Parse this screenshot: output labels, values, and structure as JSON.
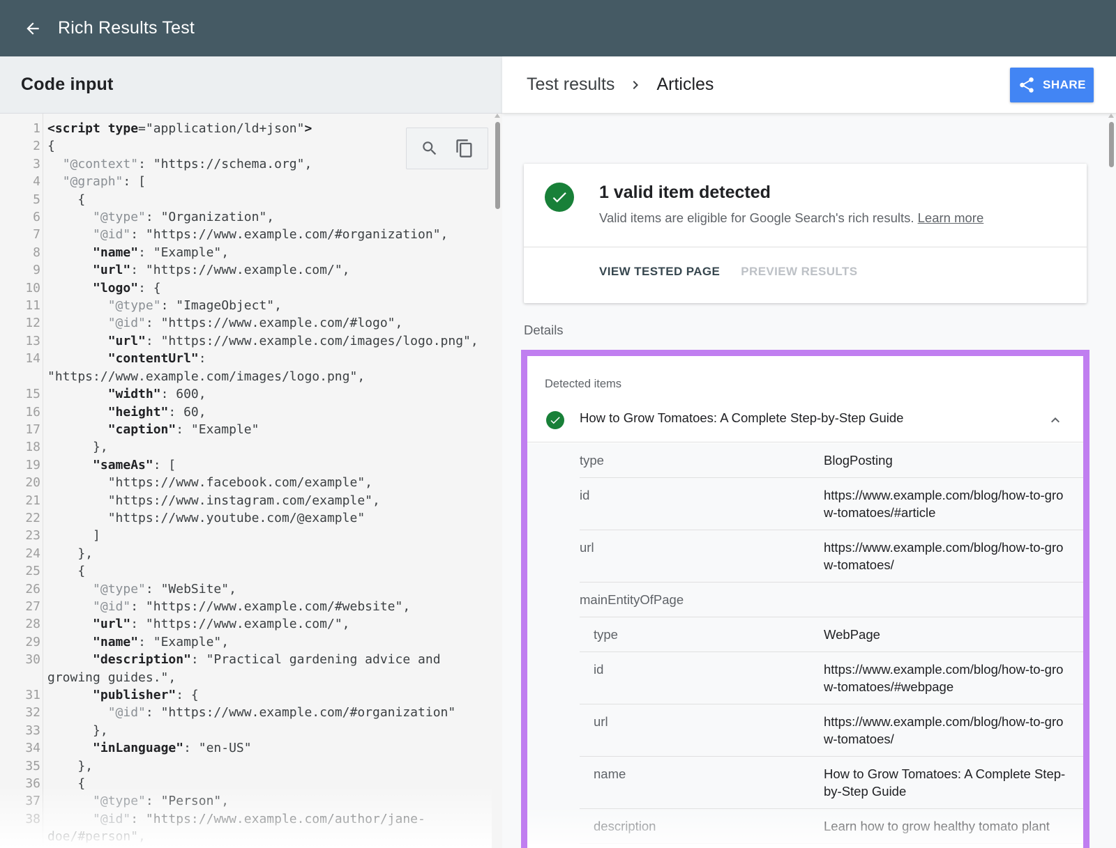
{
  "app": {
    "title": "Rich Results Test"
  },
  "left": {
    "header": "Code input",
    "code_lines": [
      {
        "n": "1",
        "t": "<script type=\"application/ld+json\">"
      },
      {
        "n": "2",
        "t": "{"
      },
      {
        "n": "3",
        "t": "  \"@context\": \"https://schema.org\","
      },
      {
        "n": "4",
        "t": "  \"@graph\": ["
      },
      {
        "n": "5",
        "t": "    {"
      },
      {
        "n": "6",
        "t": "      \"@type\": \"Organization\","
      },
      {
        "n": "7",
        "t": "      \"@id\": \"https://www.example.com/#organization\","
      },
      {
        "n": "8",
        "t": "      \"name\": \"Example\","
      },
      {
        "n": "9",
        "t": "      \"url\": \"https://www.example.com/\","
      },
      {
        "n": "10",
        "t": "      \"logo\": {"
      },
      {
        "n": "11",
        "t": "        \"@type\": \"ImageObject\","
      },
      {
        "n": "12",
        "t": "        \"@id\": \"https://www.example.com/#logo\","
      },
      {
        "n": "13",
        "t": "        \"url\": \"https://www.example.com/images/logo.png\","
      },
      {
        "n": "14",
        "t": "        \"contentUrl\":"
      },
      {
        "n": "",
        "t": "\"https://www.example.com/images/logo.png\","
      },
      {
        "n": "15",
        "t": "        \"width\": 600,"
      },
      {
        "n": "16",
        "t": "        \"height\": 60,"
      },
      {
        "n": "17",
        "t": "        \"caption\": \"Example\""
      },
      {
        "n": "18",
        "t": "      },"
      },
      {
        "n": "19",
        "t": "      \"sameAs\": ["
      },
      {
        "n": "20",
        "t": "        \"https://www.facebook.com/example\","
      },
      {
        "n": "21",
        "t": "        \"https://www.instagram.com/example\","
      },
      {
        "n": "22",
        "t": "        \"https://www.youtube.com/@example\""
      },
      {
        "n": "23",
        "t": "      ]"
      },
      {
        "n": "24",
        "t": "    },"
      },
      {
        "n": "25",
        "t": "    {"
      },
      {
        "n": "26",
        "t": "      \"@type\": \"WebSite\","
      },
      {
        "n": "27",
        "t": "      \"@id\": \"https://www.example.com/#website\","
      },
      {
        "n": "28",
        "t": "      \"url\": \"https://www.example.com/\","
      },
      {
        "n": "29",
        "t": "      \"name\": \"Example\","
      },
      {
        "n": "30",
        "t": "      \"description\": \"Practical gardening advice and"
      },
      {
        "n": "",
        "t": "growing guides.\","
      },
      {
        "n": "31",
        "t": "      \"publisher\": {"
      },
      {
        "n": "32",
        "t": "        \"@id\": \"https://www.example.com/#organization\""
      },
      {
        "n": "33",
        "t": "      },"
      },
      {
        "n": "34",
        "t": "      \"inLanguage\": \"en-US\""
      },
      {
        "n": "35",
        "t": "    },"
      },
      {
        "n": "36",
        "t": "    {"
      },
      {
        "n": "37",
        "t": "      \"@type\": \"Person\","
      },
      {
        "n": "38",
        "t": "      \"@id\": \"https://www.example.com/author/jane-"
      },
      {
        "n": "",
        "t": "doe/#person\","
      }
    ]
  },
  "right": {
    "breadcrumb": [
      "Test results",
      "Articles"
    ],
    "share_label": "SHARE",
    "summary": {
      "title": "1 valid item detected",
      "subtitle": "Valid items are eligible for Google Search's rich results.",
      "learn_more": "Learn more",
      "tab_view": "VIEW TESTED PAGE",
      "tab_preview": "PREVIEW RESULTS"
    },
    "details_label": "Details",
    "detected": {
      "label": "Detected items",
      "item_title": "How to Grow Tomatoes: A Complete Step-by-Step Guide",
      "properties": [
        {
          "k": "type",
          "v": "BlogPosting",
          "sub": false
        },
        {
          "k": "id",
          "v": "https://www.example.com/blog/how-to-grow-tomatoes/#article",
          "sub": false
        },
        {
          "k": "url",
          "v": "https://www.example.com/blog/how-to-grow-tomatoes/",
          "sub": false
        },
        {
          "k": "mainEntityOfPage",
          "v": "",
          "sub": false
        },
        {
          "k": "type",
          "v": "WebPage",
          "sub": true
        },
        {
          "k": "id",
          "v": "https://www.example.com/blog/how-to-grow-tomatoes/#webpage",
          "sub": true
        },
        {
          "k": "url",
          "v": "https://www.example.com/blog/how-to-grow-tomatoes/",
          "sub": true
        },
        {
          "k": "name",
          "v": "How to Grow Tomatoes: A Complete Step-by-Step Guide",
          "sub": true
        },
        {
          "k": "description",
          "v": "Learn how to grow healthy tomato plant",
          "sub": true
        }
      ]
    }
  },
  "colors": {
    "appbar": "#455a64",
    "share_button": "#4285f4",
    "valid_green": "#188038",
    "highlight_border": "#c07ef0"
  },
  "icons": [
    "back-arrow-icon",
    "search-icon",
    "copy-icon",
    "chevron-right-icon",
    "share-icon",
    "check-circle-icon",
    "chevron-up-icon"
  ]
}
